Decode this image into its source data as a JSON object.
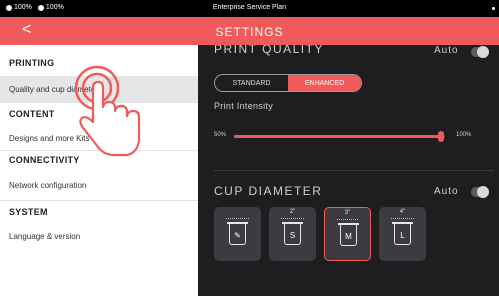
{
  "statusbar": {
    "wifi": "100%",
    "battery": "100%",
    "center": "Enterprise Service Plan"
  },
  "header": {
    "back": "<",
    "title": "SETTINGS"
  },
  "sidebar": {
    "sections": [
      {
        "title": "PRINTING",
        "items": [
          "Quality and cup diameter"
        ]
      },
      {
        "title": "CONTENT",
        "items": [
          "Designs and more Kits"
        ]
      },
      {
        "title": "CONNECTIVITY",
        "items": [
          "Network configuration"
        ]
      },
      {
        "title": "SYSTEM",
        "items": [
          "Language & version"
        ]
      }
    ]
  },
  "print_quality": {
    "label": "PRINT QUALITY",
    "auto": "Auto",
    "auto_on": false,
    "options": [
      "STANDARD",
      "ENHANCED"
    ],
    "selected": "ENHANCED"
  },
  "intensity": {
    "label": "Print Intensity",
    "min": "50%",
    "max": "100%",
    "value_fraction": 0.98
  },
  "cup_diameter": {
    "label": "CUP DIAMETER",
    "auto": "Auto",
    "auto_on": false,
    "options": [
      {
        "size": "",
        "letter": "✎",
        "icon": "pencil-icon"
      },
      {
        "size": "2\"",
        "letter": "S"
      },
      {
        "size": "3\"",
        "letter": "M"
      },
      {
        "size": "4\"",
        "letter": "L"
      }
    ],
    "selected_index": 2
  },
  "colors": {
    "accent": "#ef5b5b",
    "dark_bg": "#1e1e21",
    "tile_bg": "#3b3b40"
  },
  "overlay": {
    "icon": "tap-hand-icon"
  }
}
